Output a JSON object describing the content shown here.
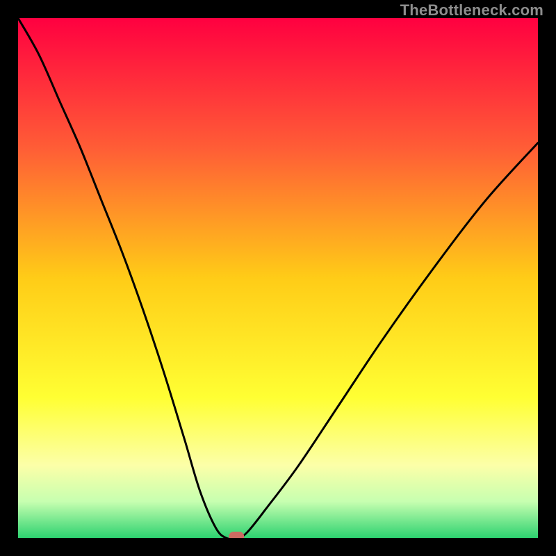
{
  "watermark": "TheBottleneck.com",
  "gradient_stops": [
    {
      "offset": "0%",
      "color": "#ff0040"
    },
    {
      "offset": "25%",
      "color": "#ff5d36"
    },
    {
      "offset": "50%",
      "color": "#ffcc17"
    },
    {
      "offset": "73%",
      "color": "#ffff33"
    },
    {
      "offset": "86%",
      "color": "#fcffa8"
    },
    {
      "offset": "93%",
      "color": "#c7ffb0"
    },
    {
      "offset": "100%",
      "color": "#2dd270"
    }
  ],
  "chart_data": {
    "type": "line",
    "title": "",
    "xlabel": "",
    "ylabel": "",
    "x_range": [
      0,
      100
    ],
    "y_range": [
      0,
      100
    ],
    "optimum_x": 42,
    "series": [
      {
        "name": "bottleneck",
        "x": [
          0,
          4,
          8,
          12,
          16,
          20,
          24,
          28,
          32,
          35,
          38,
          40,
          42,
          44,
          48,
          54,
          62,
          70,
          80,
          90,
          100
        ],
        "y": [
          100,
          93,
          84,
          75,
          65,
          55,
          44,
          32,
          19,
          9,
          2,
          0,
          0,
          1,
          6,
          14,
          26,
          38,
          52,
          65,
          76
        ]
      }
    ],
    "marker": {
      "x": 42,
      "y": 0,
      "color": "#cc6b62"
    }
  }
}
